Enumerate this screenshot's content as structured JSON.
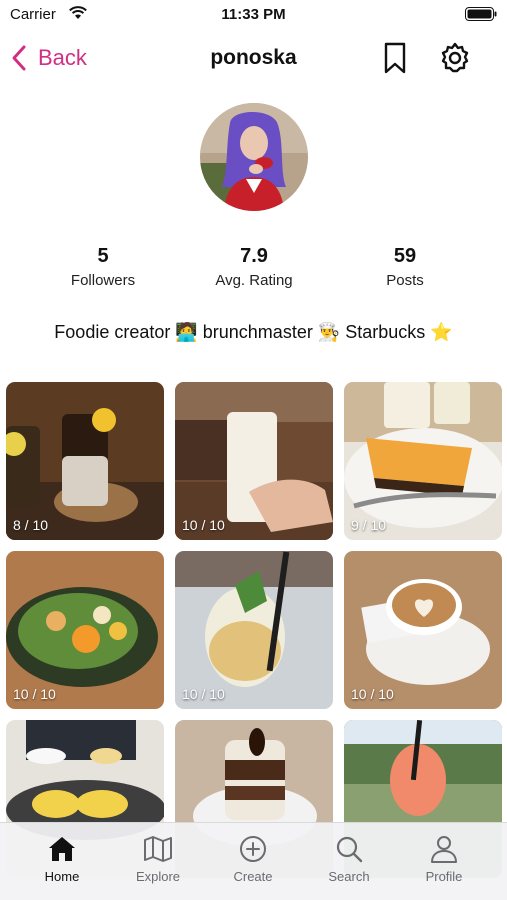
{
  "status_bar": {
    "carrier": "Carrier",
    "time": "11:33 PM"
  },
  "nav": {
    "back_label": "Back",
    "title": "ponoska"
  },
  "profile": {
    "stats": [
      {
        "value": "5",
        "label": "Followers"
      },
      {
        "value": "7.9",
        "label": "Avg. Rating"
      },
      {
        "value": "59",
        "label": "Posts"
      }
    ],
    "bio": "Foodie creator 🧑‍💻 brunchmaster 👨‍🍳 Starbucks ⭐"
  },
  "posts": [
    {
      "rating": "8 / 10",
      "subject": "iced coffee drinks"
    },
    {
      "rating": "10 / 10",
      "subject": "milk drink"
    },
    {
      "rating": "9 / 10",
      "subject": "cheesecake"
    },
    {
      "rating": "10 / 10",
      "subject": "salad bowl"
    },
    {
      "rating": "10 / 10",
      "subject": "iced tea"
    },
    {
      "rating": "10 / 10",
      "subject": "latte"
    },
    {
      "rating": "",
      "subject": "eggs benedict"
    },
    {
      "rating": "",
      "subject": "tiramisu"
    },
    {
      "rating": "",
      "subject": "spritz"
    }
  ],
  "tabs": [
    {
      "label": "Home",
      "icon": "home-icon",
      "active": true
    },
    {
      "label": "Explore",
      "icon": "map-icon"
    },
    {
      "label": "Create",
      "icon": "plus-circle-icon"
    },
    {
      "label": "Search",
      "icon": "search-icon"
    },
    {
      "label": "Profile",
      "icon": "person-icon"
    }
  ],
  "colors": {
    "accent": "#d12f83",
    "tab_active": "#111111",
    "tab_inactive": "#6b6b70"
  }
}
